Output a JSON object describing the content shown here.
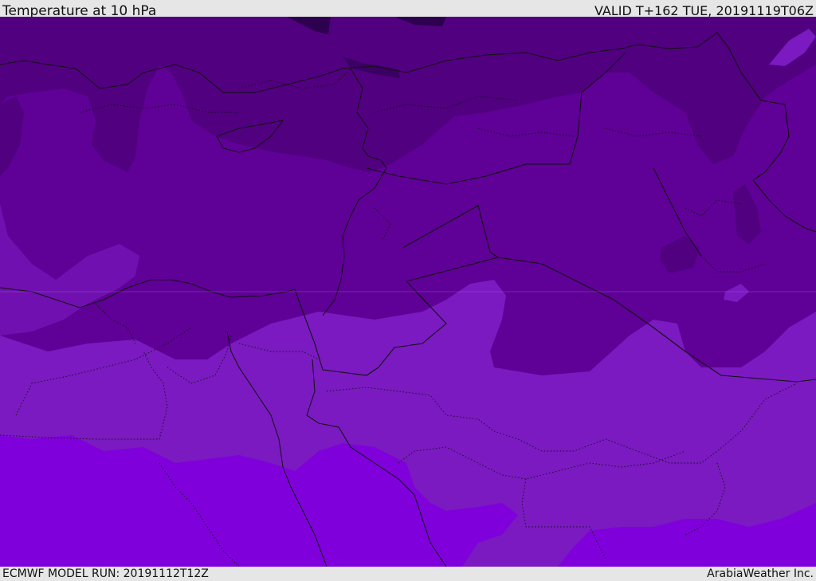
{
  "header": {
    "title": "Temperature at 10 hPa",
    "valid": "VALID T+162 TUE, 20191119T06Z"
  },
  "footer": {
    "model_run": "ECMWF MODEL RUN: 20191112T12Z",
    "provider": "ArabiaWeather Inc."
  },
  "colors": {
    "band_darkest": "#2d0050",
    "band_dark": "#510080",
    "band_mid": "#5f0096",
    "band_light": "#7010b0",
    "band_lighter": "#7a1ac0",
    "band_brightest": "#7f00db",
    "borders": "#111111"
  }
}
